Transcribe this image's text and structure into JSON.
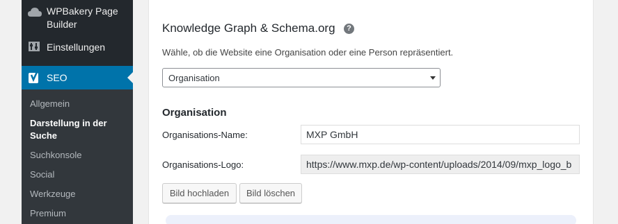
{
  "sidebar": {
    "wpbakery_label": "WPBakery Page Builder",
    "settings_label": "Einstellungen",
    "seo_label": "SEO",
    "submenu": [
      {
        "label": "Allgemein"
      },
      {
        "label": "Darstellung in der Suche"
      },
      {
        "label": "Suchkonsole"
      },
      {
        "label": "Social"
      },
      {
        "label": "Werkzeuge"
      },
      {
        "label": "Premium"
      }
    ]
  },
  "main": {
    "section_title": "Knowledge Graph & Schema.org",
    "help_icon": "?",
    "description": "Wähle, ob die Website eine Organisation oder eine Person repräsentiert.",
    "select_value": "Organisation",
    "subsection_title": "Organisation",
    "name_label": "Organisations-Name:",
    "name_value": "MXP GmbH",
    "logo_label": "Organisations-Logo:",
    "logo_value": "https://www.mxp.de/wp-content/uploads/2014/09/mxp_logo_b",
    "upload_button": "Bild hochladen",
    "delete_button": "Bild löschen"
  },
  "colors": {
    "sidebar": "#23282d",
    "submenu": "#32373c",
    "active": "#0073aa"
  }
}
